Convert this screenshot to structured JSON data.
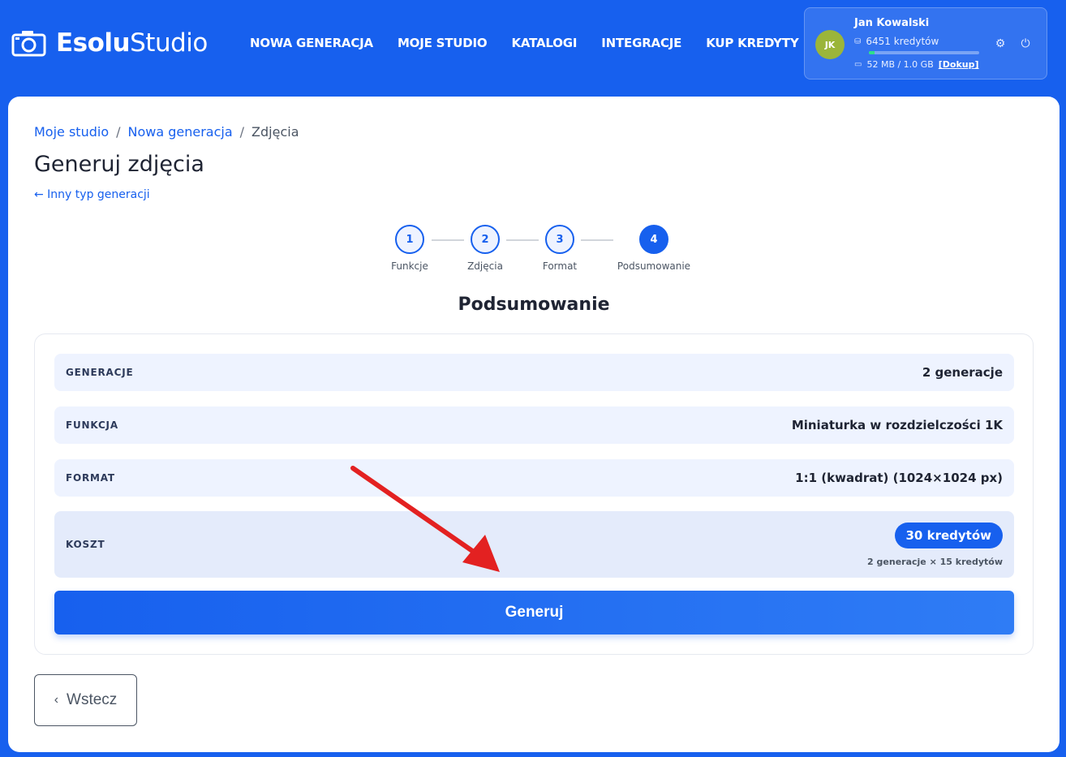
{
  "brand": {
    "bold": "Esolu",
    "light": "Studio"
  },
  "nav": [
    "NOWA GENERACJA",
    "MOJE STUDIO",
    "KATALOGI",
    "INTEGRACJE",
    "KUP KREDYTY"
  ],
  "user": {
    "initials": "JK",
    "name": "Jan Kowalski",
    "credits": "6451 kredytów",
    "storage": "52 MB / 1.0 GB",
    "storage_used_fraction": 0.05,
    "topup_label": "[Dokup]",
    "avatar_color": "#9bb53a"
  },
  "breadcrumb": [
    "Moje studio",
    "Nowa generacja",
    "Zdjęcia"
  ],
  "page_title": "Generuj zdjęcia",
  "back_link": "← Inny typ generacji",
  "steps": [
    {
      "number": "1",
      "label": "Funkcje"
    },
    {
      "number": "2",
      "label": "Zdjęcia"
    },
    {
      "number": "3",
      "label": "Format"
    },
    {
      "number": "4",
      "label": "Podsumowanie"
    }
  ],
  "summary": {
    "title": "Podsumowanie",
    "rows": [
      {
        "key": "GENERACJE",
        "value": "2 generacje"
      },
      {
        "key": "FUNKCJA",
        "value": "Miniaturka w rozdzielczości 1K"
      },
      {
        "key": "FORMAT",
        "value": "1:1 (kwadrat) (1024×1024 px)"
      }
    ],
    "cost": {
      "key": "KOSZT",
      "value": "30 kredytów",
      "note": "2 generacje × 15 kredytów"
    }
  },
  "generate_button": "Generuj",
  "back_button": "Wstecz",
  "colors": {
    "primary": "#1760ee",
    "row_bg": "#eef3ff",
    "arrow": "#e32121"
  }
}
